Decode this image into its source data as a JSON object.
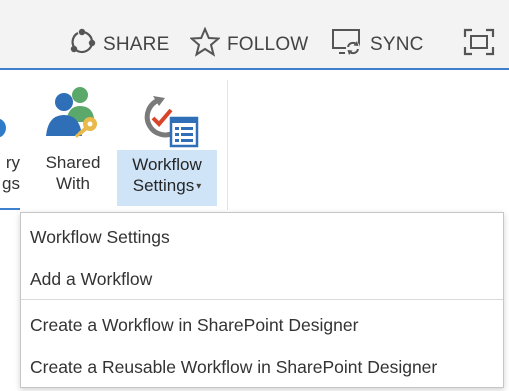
{
  "top_bar": {
    "share_label": "SHARE",
    "follow_label": "FOLLOW",
    "sync_label": "SYNC",
    "icons": {
      "share": "share-circular-icon",
      "follow": "star-outline-icon",
      "sync": "sync-monitor-icon",
      "focus": "focus-frame-icon"
    }
  },
  "ribbon": {
    "partial_button": {
      "line1": "ry",
      "line2": "gs"
    },
    "shared_with": {
      "line1": "Shared",
      "line2": "With",
      "icon": "users-with-key-icon"
    },
    "workflow_settings": {
      "line1": "Workflow",
      "line2": "Settings",
      "icon": "workflow-gear-check-icon",
      "caret": "▾"
    }
  },
  "dropdown_menu": {
    "items": [
      {
        "label": "Workflow Settings"
      },
      {
        "label": "Add a Workflow"
      },
      {
        "label": "Create a Workflow in SharePoint Designer"
      },
      {
        "label": "Create a Reusable Workflow in SharePoint Designer"
      }
    ]
  },
  "colors": {
    "accent": "#3f7fd0",
    "selected_button": "#cfe4f7",
    "topbar_bg": "#f3f3f3"
  }
}
